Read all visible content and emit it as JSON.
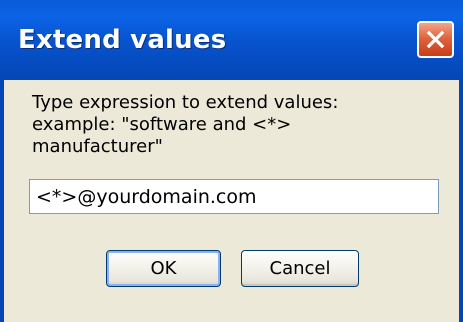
{
  "window": {
    "title": "Extend values"
  },
  "prompt": {
    "line1": "Type expression to extend values:",
    "line2": "example: \"software and <*>",
    "line3": "manufacturer\""
  },
  "input": {
    "value": "<*>@yourdomain.com"
  },
  "buttons": {
    "ok_label": "OK",
    "cancel_label": "Cancel"
  },
  "icons": {
    "close": "close-icon"
  },
  "colors": {
    "titlebar": "#0752cc",
    "dialog_background": "#ece9d8",
    "close_button": "#e0643f"
  }
}
